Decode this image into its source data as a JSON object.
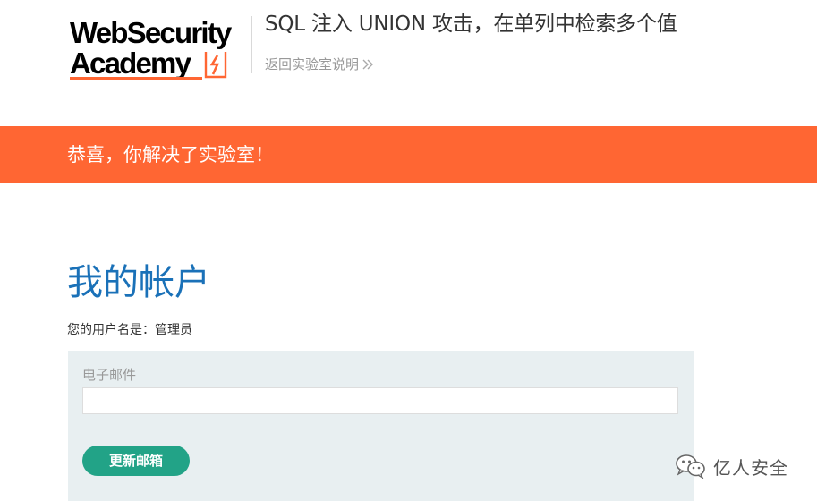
{
  "header": {
    "logo_line1": "WebSecurity",
    "logo_line2": "Academy",
    "lab_title": "SQL 注入 UNION 攻击，在单列中检索多个值",
    "back_link": "返回实验室说明"
  },
  "banner": {
    "text": "恭喜，你解决了实验室！"
  },
  "account": {
    "heading": "我的帐户",
    "username_line": "您的用户名是：管理员",
    "email_label": "电子邮件",
    "email_value": "",
    "update_button": "更新邮箱"
  },
  "watermark": {
    "text": "亿人安全",
    "icon": "wechat-icon"
  },
  "colors": {
    "banner_bg": "#ff6633",
    "heading": "#1a71b8",
    "button_bg": "#22a387",
    "panel_bg": "#e8eff1",
    "logo_accent": "#ff6633"
  }
}
